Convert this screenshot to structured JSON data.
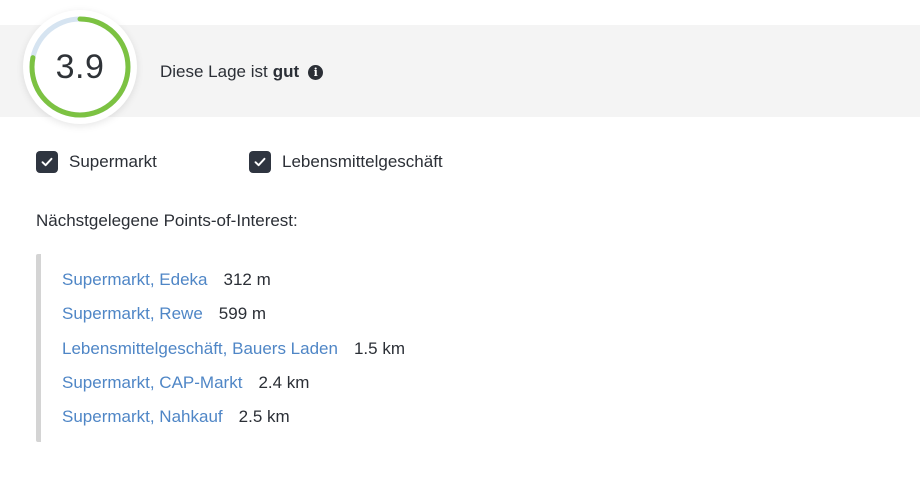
{
  "score": {
    "value": "3.9",
    "fraction": 0.78,
    "color_filled": "#7cc242",
    "color_empty": "#d6e4f1"
  },
  "rating": {
    "prefix": "Diese Lage ist",
    "value": "gut",
    "info_icon": "info-icon"
  },
  "filters": [
    {
      "label": "Supermarkt",
      "checked": true
    },
    {
      "label": "Lebensmittelgeschäft",
      "checked": true
    }
  ],
  "poi": {
    "heading": "Nächstgelegene Points-of-Interest:",
    "items": [
      {
        "name": "Supermarkt, Edeka",
        "distance": "312 m"
      },
      {
        "name": "Supermarkt, Rewe",
        "distance": "599 m"
      },
      {
        "name": "Lebensmittelgeschäft, Bauers Laden",
        "distance": "1.5 km"
      },
      {
        "name": "Supermarkt, CAP-Markt",
        "distance": "2.4 km"
      },
      {
        "name": "Supermarkt, Nahkauf",
        "distance": "2.5 km"
      }
    ]
  },
  "colors": {
    "link": "#4f86c6",
    "text": "#2b2f36",
    "checkbox": "#2f3540",
    "banner": "#f4f4f4"
  }
}
